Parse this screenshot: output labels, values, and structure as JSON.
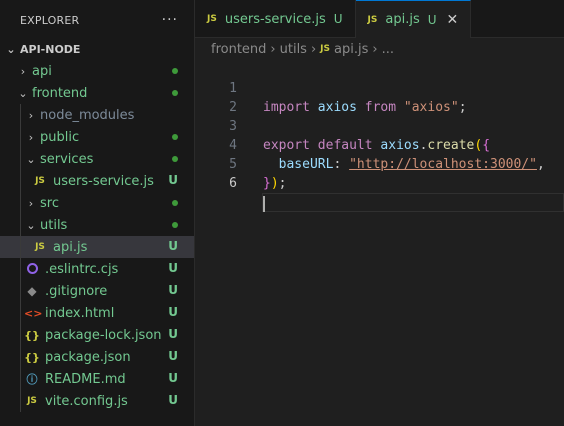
{
  "sidebar": {
    "title": "EXPLORER",
    "more": "···",
    "root": "API-NODE",
    "items": [
      {
        "label": "api",
        "badge": "dot"
      },
      {
        "label": "frontend",
        "badge": "dot"
      },
      {
        "label": "node_modules"
      },
      {
        "label": "public",
        "badge": "dot"
      },
      {
        "label": "services",
        "badge": "dot"
      },
      {
        "label": "users-service.js",
        "badge": "U"
      },
      {
        "label": "src",
        "badge": "dot"
      },
      {
        "label": "utils",
        "badge": "dot"
      },
      {
        "label": "api.js",
        "badge": "U"
      },
      {
        "label": ".eslintrc.cjs",
        "badge": "U"
      },
      {
        "label": ".gitignore",
        "badge": "U"
      },
      {
        "label": "index.html",
        "badge": "U"
      },
      {
        "label": "package-lock.json",
        "badge": "U"
      },
      {
        "label": "package.json",
        "badge": "U"
      },
      {
        "label": "README.md",
        "badge": "U"
      },
      {
        "label": "vite.config.js",
        "badge": "U"
      }
    ]
  },
  "tabs": [
    {
      "icon": "JS",
      "label": "users-service.js",
      "status": "U"
    },
    {
      "icon": "JS",
      "label": "api.js",
      "status": "U",
      "close": "✕"
    }
  ],
  "breadcrumb": {
    "parts": [
      "frontend",
      "utils",
      "api.js",
      "..."
    ],
    "sep": "›",
    "icon": "JS"
  },
  "code": {
    "lines": [
      "1",
      "2",
      "3",
      "4",
      "5",
      "6"
    ],
    "tokens": {
      "import": "import",
      "axios": "axios",
      "from": "from",
      "axios_str": "\"axios\"",
      "semi": ";",
      "export": "export",
      "default": "default",
      "create": "create",
      "dot": ".",
      "open": "(",
      "brace_open": "{",
      "baseURL": "baseURL",
      "colon": ":",
      "url": "\"http://localhost:3000/\"",
      "comma": ",",
      "brace_close": "}",
      "close": ")"
    }
  },
  "colors": {
    "untracked": "#73c991",
    "accent": "#0078d4",
    "js_icon": "#cbcb41"
  }
}
